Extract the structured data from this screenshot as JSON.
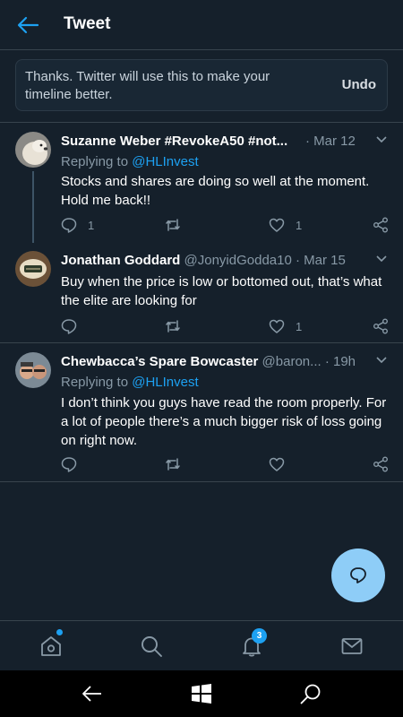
{
  "header": {
    "title": "Tweet"
  },
  "toast": {
    "message": "Thanks. Twitter will use this to make your timeline better.",
    "undo_label": "Undo"
  },
  "tweets": [
    {
      "name": "Suzanne Weber #RevokeA50 #not...",
      "handle": "",
      "time": "· Mar 12",
      "replying_prefix": "Replying to ",
      "replying_to": "@HLInvest",
      "text": "Stocks and shares are doing so well at the moment. Hold me  back!!",
      "reply_count": "1",
      "retweet_count": "",
      "like_count": "1"
    },
    {
      "name": "Jonathan Goddard",
      "handle": " @JonyidGodda10",
      "time": " · Mar 15",
      "replying_prefix": "",
      "replying_to": "",
      "text": "Buy when the price is low or bottomed out, that’s what the elite are looking for",
      "reply_count": "",
      "retweet_count": "",
      "like_count": "1"
    },
    {
      "name": "Chewbacca’s Spare Bowcaster",
      "handle": " @baron...",
      "time": " · 19h",
      "replying_prefix": "Replying to ",
      "replying_to": "@HLInvest",
      "text": "I don’t think you guys have read the room properly. For a lot of people there’s a much bigger risk of loss going on right now.",
      "reply_count": "",
      "retweet_count": "",
      "like_count": ""
    }
  ],
  "nav": {
    "notifications_badge": "3"
  },
  "colors": {
    "background": "#15202b",
    "accent": "#1da1f2",
    "secondary_text": "#8899a6",
    "fab": "#8ecdf7"
  },
  "icons": [
    "back-arrow-icon",
    "chevron-down-icon",
    "reply-icon",
    "retweet-icon",
    "heart-icon",
    "share-icon",
    "compose-icon",
    "home-icon",
    "search-icon",
    "bell-icon",
    "mail-icon",
    "windows-back-icon",
    "windows-logo-icon",
    "windows-search-icon"
  ]
}
